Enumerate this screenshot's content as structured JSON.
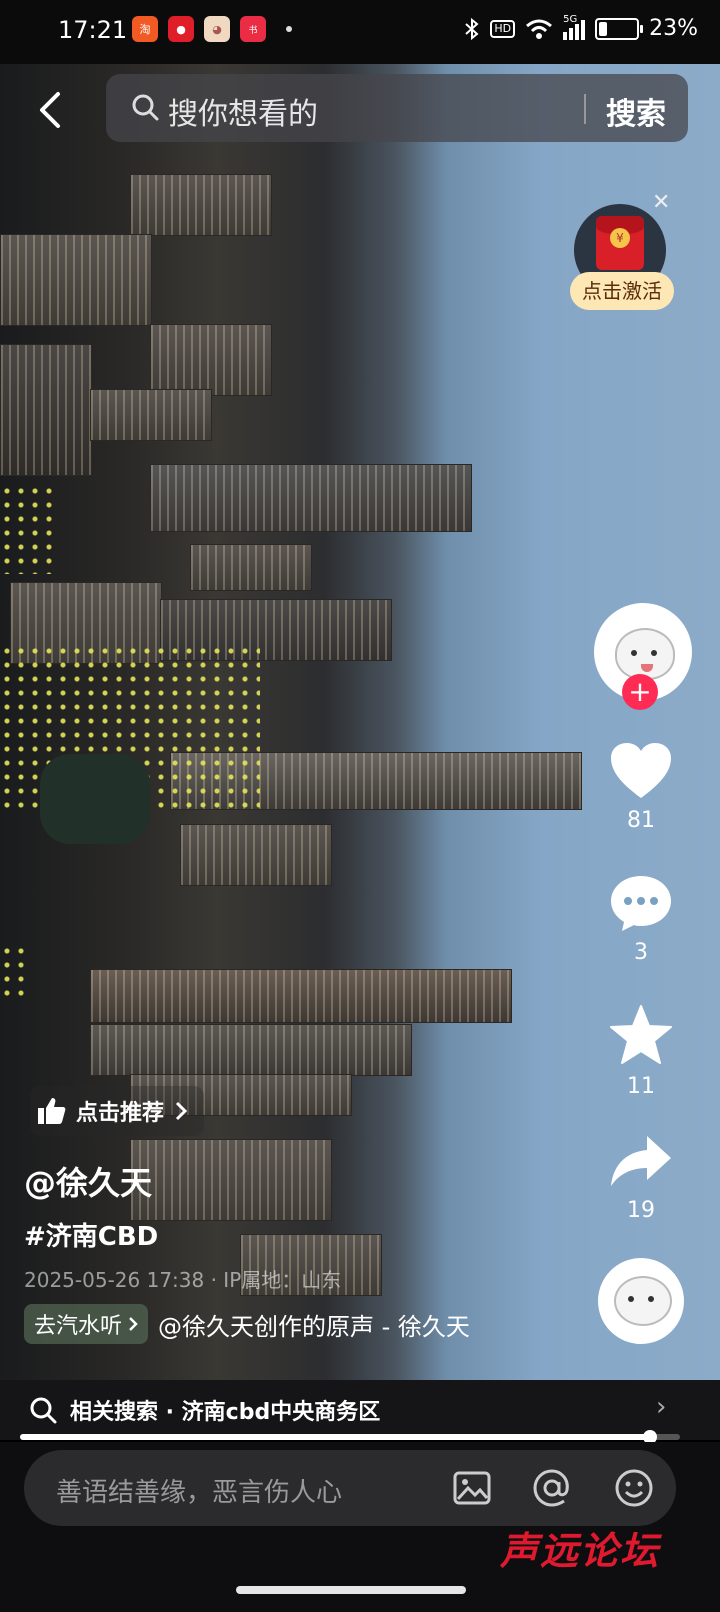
{
  "status_bar": {
    "time": "17:21",
    "network": "5G",
    "hd": "HD",
    "battery": "23%",
    "battery_level": 0.23,
    "notification_icons": [
      {
        "name": "taobao-icon",
        "color": "#f25a23"
      },
      {
        "name": "app-red-icon",
        "color": "#e01e2a"
      },
      {
        "name": "cartoon-app-icon",
        "color": "#f0d9c0"
      },
      {
        "name": "xiaohongshu-icon",
        "color": "#ea2d44"
      }
    ]
  },
  "search": {
    "placeholder": "搜你想看的",
    "submit_label": "搜索"
  },
  "promo": {
    "label": "点击激活"
  },
  "actions": {
    "likes": "81",
    "comments": "3",
    "favorites": "11",
    "shares": "19"
  },
  "post": {
    "recommend_label": "点击推荐",
    "author": "@徐久天",
    "hashtag": "#济南CBD",
    "meta": "2025-05-26 17:38 · IP属地：山东",
    "music_chip": "去汽水听",
    "music": "@徐久天创作的原声 - 徐久天"
  },
  "related": {
    "text": "相关搜索 · 济南cbd中央商务区"
  },
  "playback": {
    "progress": 0.955
  },
  "comment": {
    "placeholder": "善语结善缘，恶言伤人心"
  },
  "watermark": {
    "text": "声远论坛"
  },
  "colors": {
    "accent": "#fe2c55",
    "promo_bg": "#fde7b4",
    "sky": "#8cabc9"
  }
}
